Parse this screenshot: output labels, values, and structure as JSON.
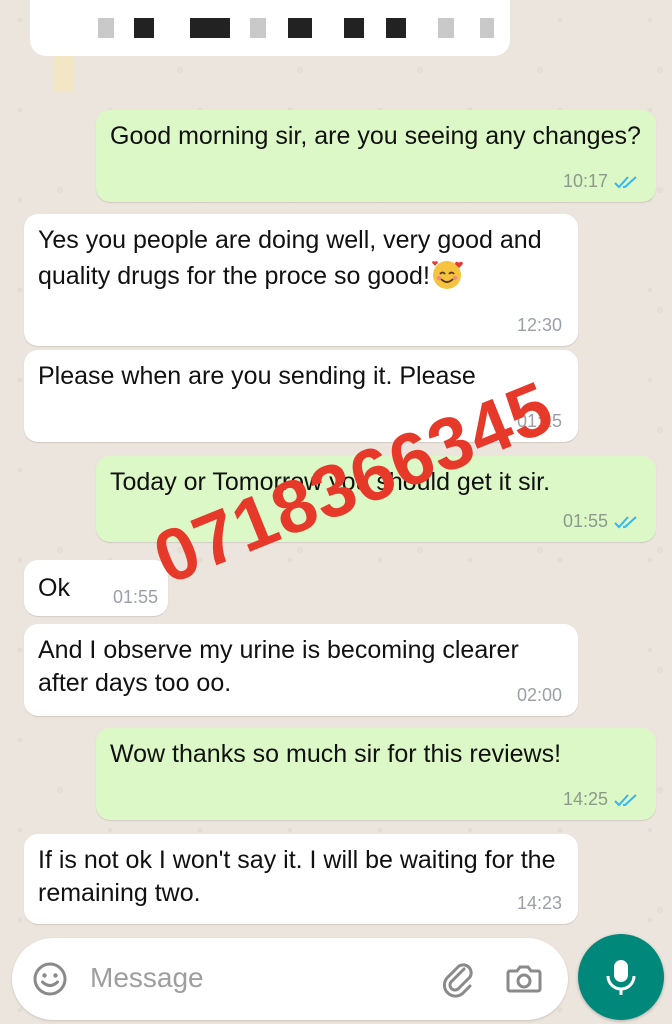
{
  "theme": {
    "outgoing_bubble_color": "#dcf8c6",
    "incoming_bubble_color": "#ffffff",
    "read_tick_color": "#34b7f1",
    "accent_color": "#00897b",
    "watermark_color": "#e6392a"
  },
  "messages": [
    {
      "direction": "outgoing",
      "text": "Good morning sir, are you seeing any changes?",
      "time": "10:17",
      "status": "read"
    },
    {
      "direction": "incoming",
      "text": "Yes you people are doing well, very good and quality drugs for the proce so good!",
      "emoji": "smiling-face-with-hearts",
      "time": "12:30"
    },
    {
      "direction": "incoming",
      "text": "Please when are you sending it. Please",
      "time": "01:15"
    },
    {
      "direction": "outgoing",
      "text": "Today or Tomorrow you should get it sir.",
      "time": "01:55",
      "status": "read"
    },
    {
      "direction": "incoming",
      "text": "Ok",
      "time": "01:55"
    },
    {
      "direction": "incoming",
      "text": "And I observe my urine is becoming clearer after days too oo.",
      "time": "02:00"
    },
    {
      "direction": "outgoing",
      "text": "Wow thanks so much sir for this reviews!",
      "time": "14:25",
      "status": "read"
    },
    {
      "direction": "incoming",
      "text": "If is not ok I won't say it. I will be waiting for the remaining two.",
      "time": "14:23"
    }
  ],
  "watermark": {
    "text": "0718366345"
  },
  "composer": {
    "placeholder": "Message",
    "icons": [
      "emoji-icon",
      "attach-icon",
      "camera-icon",
      "mic-icon"
    ]
  }
}
